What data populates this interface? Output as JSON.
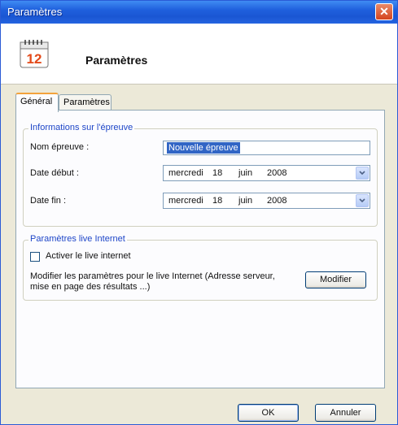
{
  "window": {
    "title": "Paramètres"
  },
  "header": {
    "title": "Paramètres",
    "icon_number": "12"
  },
  "tabs": [
    {
      "label": "Général",
      "active": true
    },
    {
      "label": "Paramètres",
      "active": false
    }
  ],
  "event_group": {
    "legend": "Informations sur l'épreuve",
    "name_label": "Nom épreuve :",
    "name_value": "Nouvelle épreuve",
    "start_label": "Date début :",
    "start": {
      "weekday": "mercredi",
      "day": "18",
      "month": "juin",
      "year": "2008"
    },
    "end_label": "Date fin :",
    "end": {
      "weekday": "mercredi",
      "day": "18",
      "month": "juin",
      "year": "2008"
    }
  },
  "live_group": {
    "legend": "Paramètres live Internet",
    "checkbox_label": "Activer le live internet",
    "checkbox_checked": false,
    "description_line1": "Modifier les paramètres pour le live Internet (Adresse serveur,",
    "description_line2": "mise en page des résultats ...)",
    "modify_button": "Modifier"
  },
  "footer": {
    "ok_label": "OK",
    "cancel_label": "Annuler"
  }
}
